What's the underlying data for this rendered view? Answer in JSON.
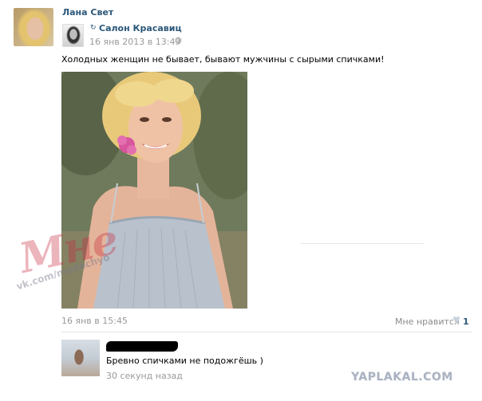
{
  "post": {
    "author_name": "Лана Свет",
    "group_name": "Салон Красавиц",
    "group_time": "16 янв 2013 в 13:49",
    "text": "Холодных женщин не бывает, бывают мужчины с сырыми спичками!",
    "date": "16 янв в 15:45",
    "like_label": "Мне нравится",
    "like_count": "1",
    "repost_icon": "repost-arrow-icon",
    "gear_icon": "gear-icon",
    "heart_icon": "heart-icon"
  },
  "comment": {
    "text": "Бревно спичками не подожгёшь )",
    "time": "30 секунд назад"
  },
  "watermarks": {
    "logo_text": "Мне",
    "site_text": "vk.com/mudachyo",
    "corner_text": "YAPLAKAL.COM"
  },
  "colors": {
    "link": "#2b587a",
    "muted": "#999999",
    "heart": "#c7d3df"
  }
}
